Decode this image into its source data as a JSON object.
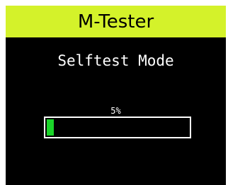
{
  "app": {
    "title": "M-Tester"
  },
  "screen": {
    "mode_label": "Selftest Mode",
    "progress": {
      "percent_label": "5%",
      "value_percent": 5
    }
  },
  "colors": {
    "title_bar": "#d4f22a",
    "background": "#000000",
    "text": "#ffffff",
    "progress_fill": "#1bd52a"
  }
}
